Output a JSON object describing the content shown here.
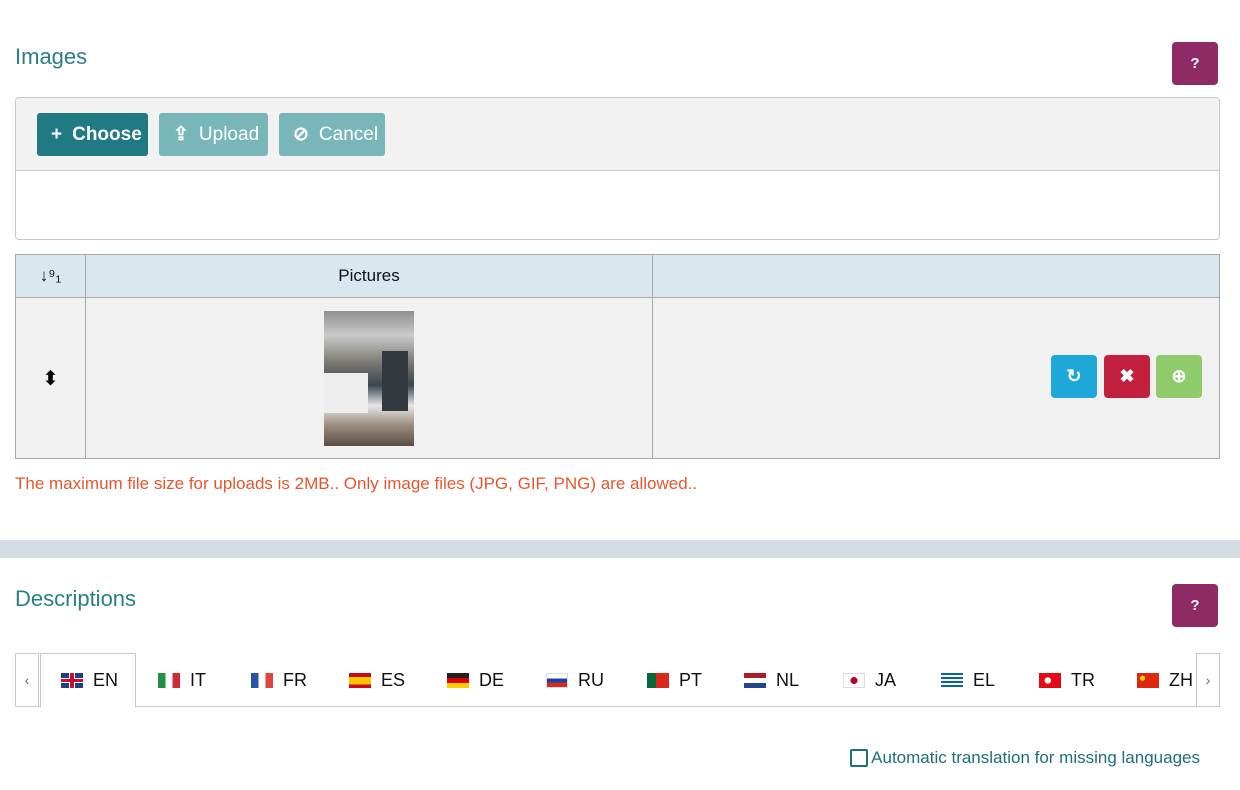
{
  "images": {
    "title": "Images",
    "help_label": "?",
    "choose_label": "Choose",
    "upload_label": "Upload",
    "cancel_label": "Cancel",
    "table": {
      "sort_header": "↓⁹₁",
      "pictures_header": "Pictures",
      "actions_header": ""
    },
    "row_handle": "⬍",
    "note": "The maximum file size for uploads is 2MB.. Only image files (JPG, GIF, PNG) are allowed.."
  },
  "actions": {
    "refresh_icon": "refresh-icon",
    "remove_icon": "close-icon",
    "zoom_icon": "zoom-in-icon"
  },
  "descriptions": {
    "title": "Descriptions",
    "help_label": "?",
    "prev": "‹",
    "next": "›",
    "tabs": [
      "EN",
      "IT",
      "FR",
      "ES",
      "DE",
      "RU",
      "PT",
      "NL",
      "JA",
      "EL",
      "TR",
      "ZH"
    ],
    "active_tab": "EN",
    "auto_translate": "Automatic translation for missing languages"
  },
  "colors": {
    "accent": "#2a7f86",
    "help": "#8e2a66",
    "refresh": "#1ea7d9",
    "remove": "#c3203f",
    "zoom": "#8fcb6a",
    "note": "#e4572e"
  }
}
